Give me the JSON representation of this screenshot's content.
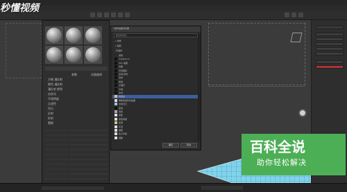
{
  "watermark": {
    "top_logo": "秒懂视频",
    "brand_title": "百科全说",
    "brand_subtitle": "助你轻松解决"
  },
  "colors": {
    "viewport_bg": "#3b3b3b",
    "panel_bg": "#2e2e2e",
    "selection": "#3b5f9e",
    "plane": "#7fd3ea",
    "watermark_green": "#4cae55"
  },
  "material_editor": {
    "slots": 6,
    "columns": [
      "参数",
      "动画曲线"
    ],
    "params": [
      {
        "label": "方格 漫反射",
        "value": "",
        "value2": ""
      },
      {
        "label": "颜色 漫反射",
        "value": "",
        "value2": ""
      },
      {
        "label": "漫反射 颜色",
        "value": "",
        "value2": ""
      },
      {
        "label": "自发光",
        "value": "",
        "value2": ""
      },
      {
        "label": "不透明度",
        "value": "",
        "value2": ""
      },
      {
        "label": "过滤色",
        "value": "",
        "value2": ""
      },
      {
        "label": "凹凸",
        "value": "",
        "value2": ""
      },
      {
        "label": "反射",
        "value": "",
        "value2": ""
      },
      {
        "label": "折射",
        "value": "",
        "value2": ""
      },
      {
        "label": "置换",
        "value": "",
        "value2": ""
      }
    ]
  },
  "dialog": {
    "title": "材质/贴图浏览器",
    "search_placeholder": "按名称搜索...",
    "sections": [
      "+ 材质",
      "+ 贴图",
      "- 扫描线"
    ],
    "items": [
      {
        "label": "通用",
        "swatch": "#2b2b2b"
      },
      {
        "label": "Substance",
        "swatch": "#111111"
      },
      {
        "label": "OSL 贴图",
        "swatch": "#111111"
      },
      {
        "label": "位图",
        "swatch": "#111111"
      },
      {
        "label": "光线跟踪",
        "swatch": "#111111"
      },
      {
        "label": "反射/折射",
        "swatch": "#111111"
      },
      {
        "label": "合成",
        "swatch": "#111111"
      },
      {
        "label": "噪波",
        "swatch": "#111111"
      },
      {
        "label": "大理石",
        "swatch": "#111111"
      },
      {
        "label": "平铺",
        "swatch": "#111111"
      },
      {
        "label": "木材",
        "swatch": "#111111"
      },
      {
        "label": "棋盘格",
        "swatch": "#d9c27a",
        "selected": true
      },
      {
        "label": "每像素摄影机贴图",
        "swatch": "#dddddd"
      },
      {
        "label": "法线凹凸",
        "swatch": "#9cc6e8"
      },
      {
        "label": "波浪",
        "swatch": "#111111"
      },
      {
        "label": "混合",
        "swatch": "#aaaaaa"
      },
      {
        "label": "渐变",
        "swatch": "#dddddd"
      },
      {
        "label": "渐变坡度",
        "swatch": "#dddddd"
      },
      {
        "label": "漩涡",
        "swatch": "#d9c27a"
      },
      {
        "label": "灰泥",
        "swatch": "#dddddd"
      },
      {
        "label": "烟雾",
        "swatch": "#dddddd"
      },
      {
        "label": "粒子年龄",
        "swatch": "#dddddd"
      },
      {
        "label": "细胞",
        "swatch": "#dddddd"
      }
    ],
    "ok_label": "确定",
    "cancel_label": "取消"
  }
}
